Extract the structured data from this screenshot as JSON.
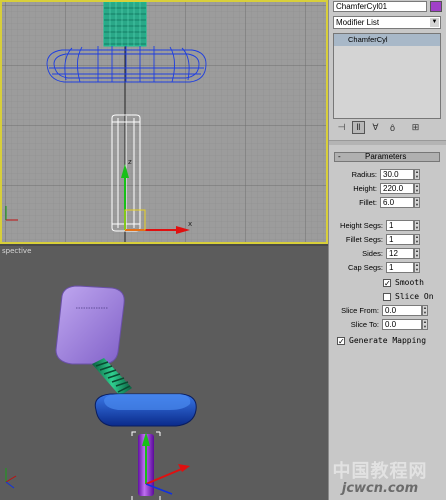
{
  "panel": {
    "object_name": "ChamferCyl01",
    "object_color": "#a040c8",
    "modifier_list": "Modifier List",
    "stack_item": "ChamferCyl",
    "stack_highlight": "#a8b8c8",
    "rollout_title": "Parameters",
    "rollout_collapse": "-",
    "fields": {
      "radius_label": "Radius:",
      "radius_value": "30.0",
      "height_label": "Height:",
      "height_value": "220.0",
      "fillet_label": "Fillet:",
      "fillet_value": "6.0",
      "height_segs_label": "Height Segs:",
      "height_segs_value": "1",
      "fillet_segs_label": "Fillet Segs:",
      "fillet_segs_value": "1",
      "sides_label": "Sides:",
      "sides_value": "12",
      "cap_segs_label": "Cap Segs:",
      "cap_segs_value": "1",
      "smooth_label": "Smooth",
      "smooth_checked": true,
      "slice_on_label": "Slice On",
      "slice_on_checked": false,
      "slice_from_label": "Slice From:",
      "slice_from_value": "0.0",
      "slice_to_label": "Slice To:",
      "slice_to_value": "0.0",
      "gen_mapping_label": "Generate Mapping",
      "gen_mapping_checked": true
    },
    "check_mark": "✓"
  },
  "viewports": {
    "perspective_label": "spective",
    "active_border_color": "#d8cf3a"
  },
  "watermark": {
    "top": "中国教程网",
    "bottom": "jcwcn.com"
  }
}
